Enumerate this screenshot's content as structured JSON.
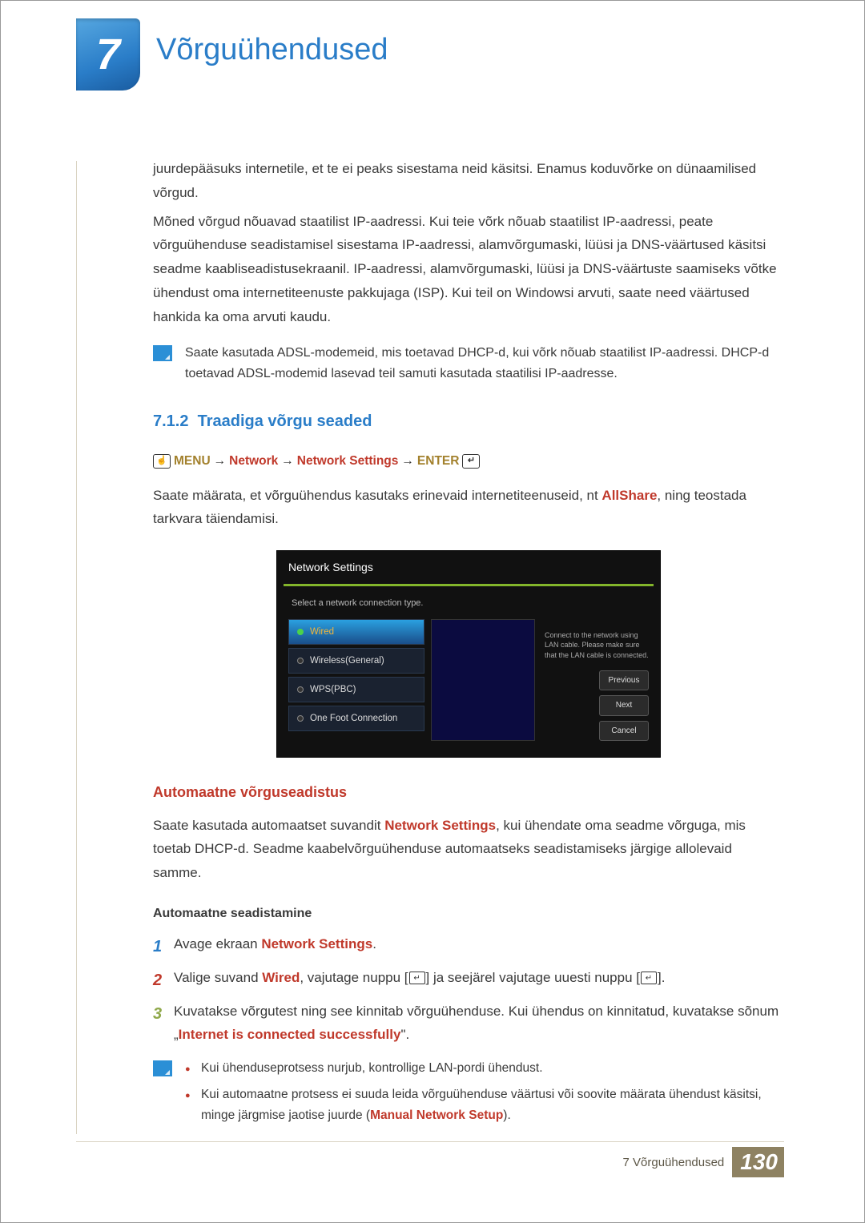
{
  "chapter": {
    "number": "7",
    "title": "Võrguühendused"
  },
  "intro": {
    "p1": "juurdepääsuks internetile, et te ei peaks sisestama neid käsitsi. Enamus koduvõrke on dünaamilised võrgud.",
    "p2": "Mõned võrgud nõuavad staatilist IP-aadressi. Kui teie võrk nõuab staatilist IP-aadressi, peate võrguühenduse seadistamisel sisestama IP-aadressi, alamvõrgumaski, lüüsi ja DNS-väärtused käsitsi seadme kaabliseadistusekraanil. IP-aadressi, alamvõrgumaski, lüüsi ja DNS-väärtuste saamiseks võtke ühendust oma internetiteenuste pakkujaga (ISP). Kui teil on Windowsi arvuti, saate need väärtused hankida ka oma arvuti kaudu."
  },
  "note1": "Saate kasutada ADSL-modemeid, mis toetavad DHCP-d, kui võrk nõuab staatilist IP-aadressi. DHCP-d toetavad ADSL-modemid lasevad teil samuti kasutada staatilisi IP-aadresse.",
  "section": {
    "num": "7.1.2",
    "title": "Traadiga võrgu seaded"
  },
  "breadcrumb": {
    "menu": "MENU",
    "a": "Network",
    "b": "Network Settings",
    "enter": "ENTER",
    "arrow": "→"
  },
  "lead": {
    "pre": "Saate määrata, et võrguühendus kasutaks erinevaid internetiteenuseid, nt ",
    "allshare": "AllShare",
    "post": ", ning teostada tarkvara täiendamisi."
  },
  "tv": {
    "title": "Network Settings",
    "sub": "Select a network connection type.",
    "options": [
      "Wired",
      "Wireless(General)",
      "WPS(PBC)",
      "One Foot Connection"
    ],
    "instruction": "Connect to the network using LAN cable. Please make sure that the LAN cable is connected.",
    "buttons": {
      "prev": "Previous",
      "next": "Next",
      "cancel": "Cancel"
    }
  },
  "auto": {
    "title": "Automaatne võrguseadistus",
    "p_pre": "Saate kasutada automaatset suvandit ",
    "p_strong": "Network Settings",
    "p_post": ", kui ühendate oma seadme võrguga, mis toetab DHCP-d. Seadme kaabelvõrguühenduse automaatseks seadistamiseks järgige allolevaid samme.",
    "minor": "Automaatne seadistamine",
    "step1_pre": "Avage ekraan ",
    "step1_strong": "Network Settings",
    "step1_post": ".",
    "step2_pre": "Valige suvand ",
    "step2_strong": "Wired",
    "step2_mid": ", vajutage nuppu [",
    "step2_mid2": "] ja seejärel vajutage uuesti nuppu [",
    "step2_end": "].",
    "step3_line1": "Kuvatakse võrgutest ning see kinnitab võrguühenduse. Kui ühendus on kinnitatud, kuvatakse sõnum",
    "step3_line2_pre": "„",
    "step3_strong": "Internet is connected successfully",
    "step3_line2_post": "\"."
  },
  "note2": {
    "b1": "Kui ühenduseprotsess nurjub, kontrollige LAN-pordi ühendust.",
    "b2_pre": "Kui automaatne protsess ei suuda leida võrguühenduse väärtusi või soovite määrata ühendust käsitsi, minge järgmise jaotise juurde (",
    "b2_strong": "Manual Network Setup",
    "b2_post": ")."
  },
  "footer": {
    "label": "7 Võrguühendused",
    "page": "130"
  }
}
